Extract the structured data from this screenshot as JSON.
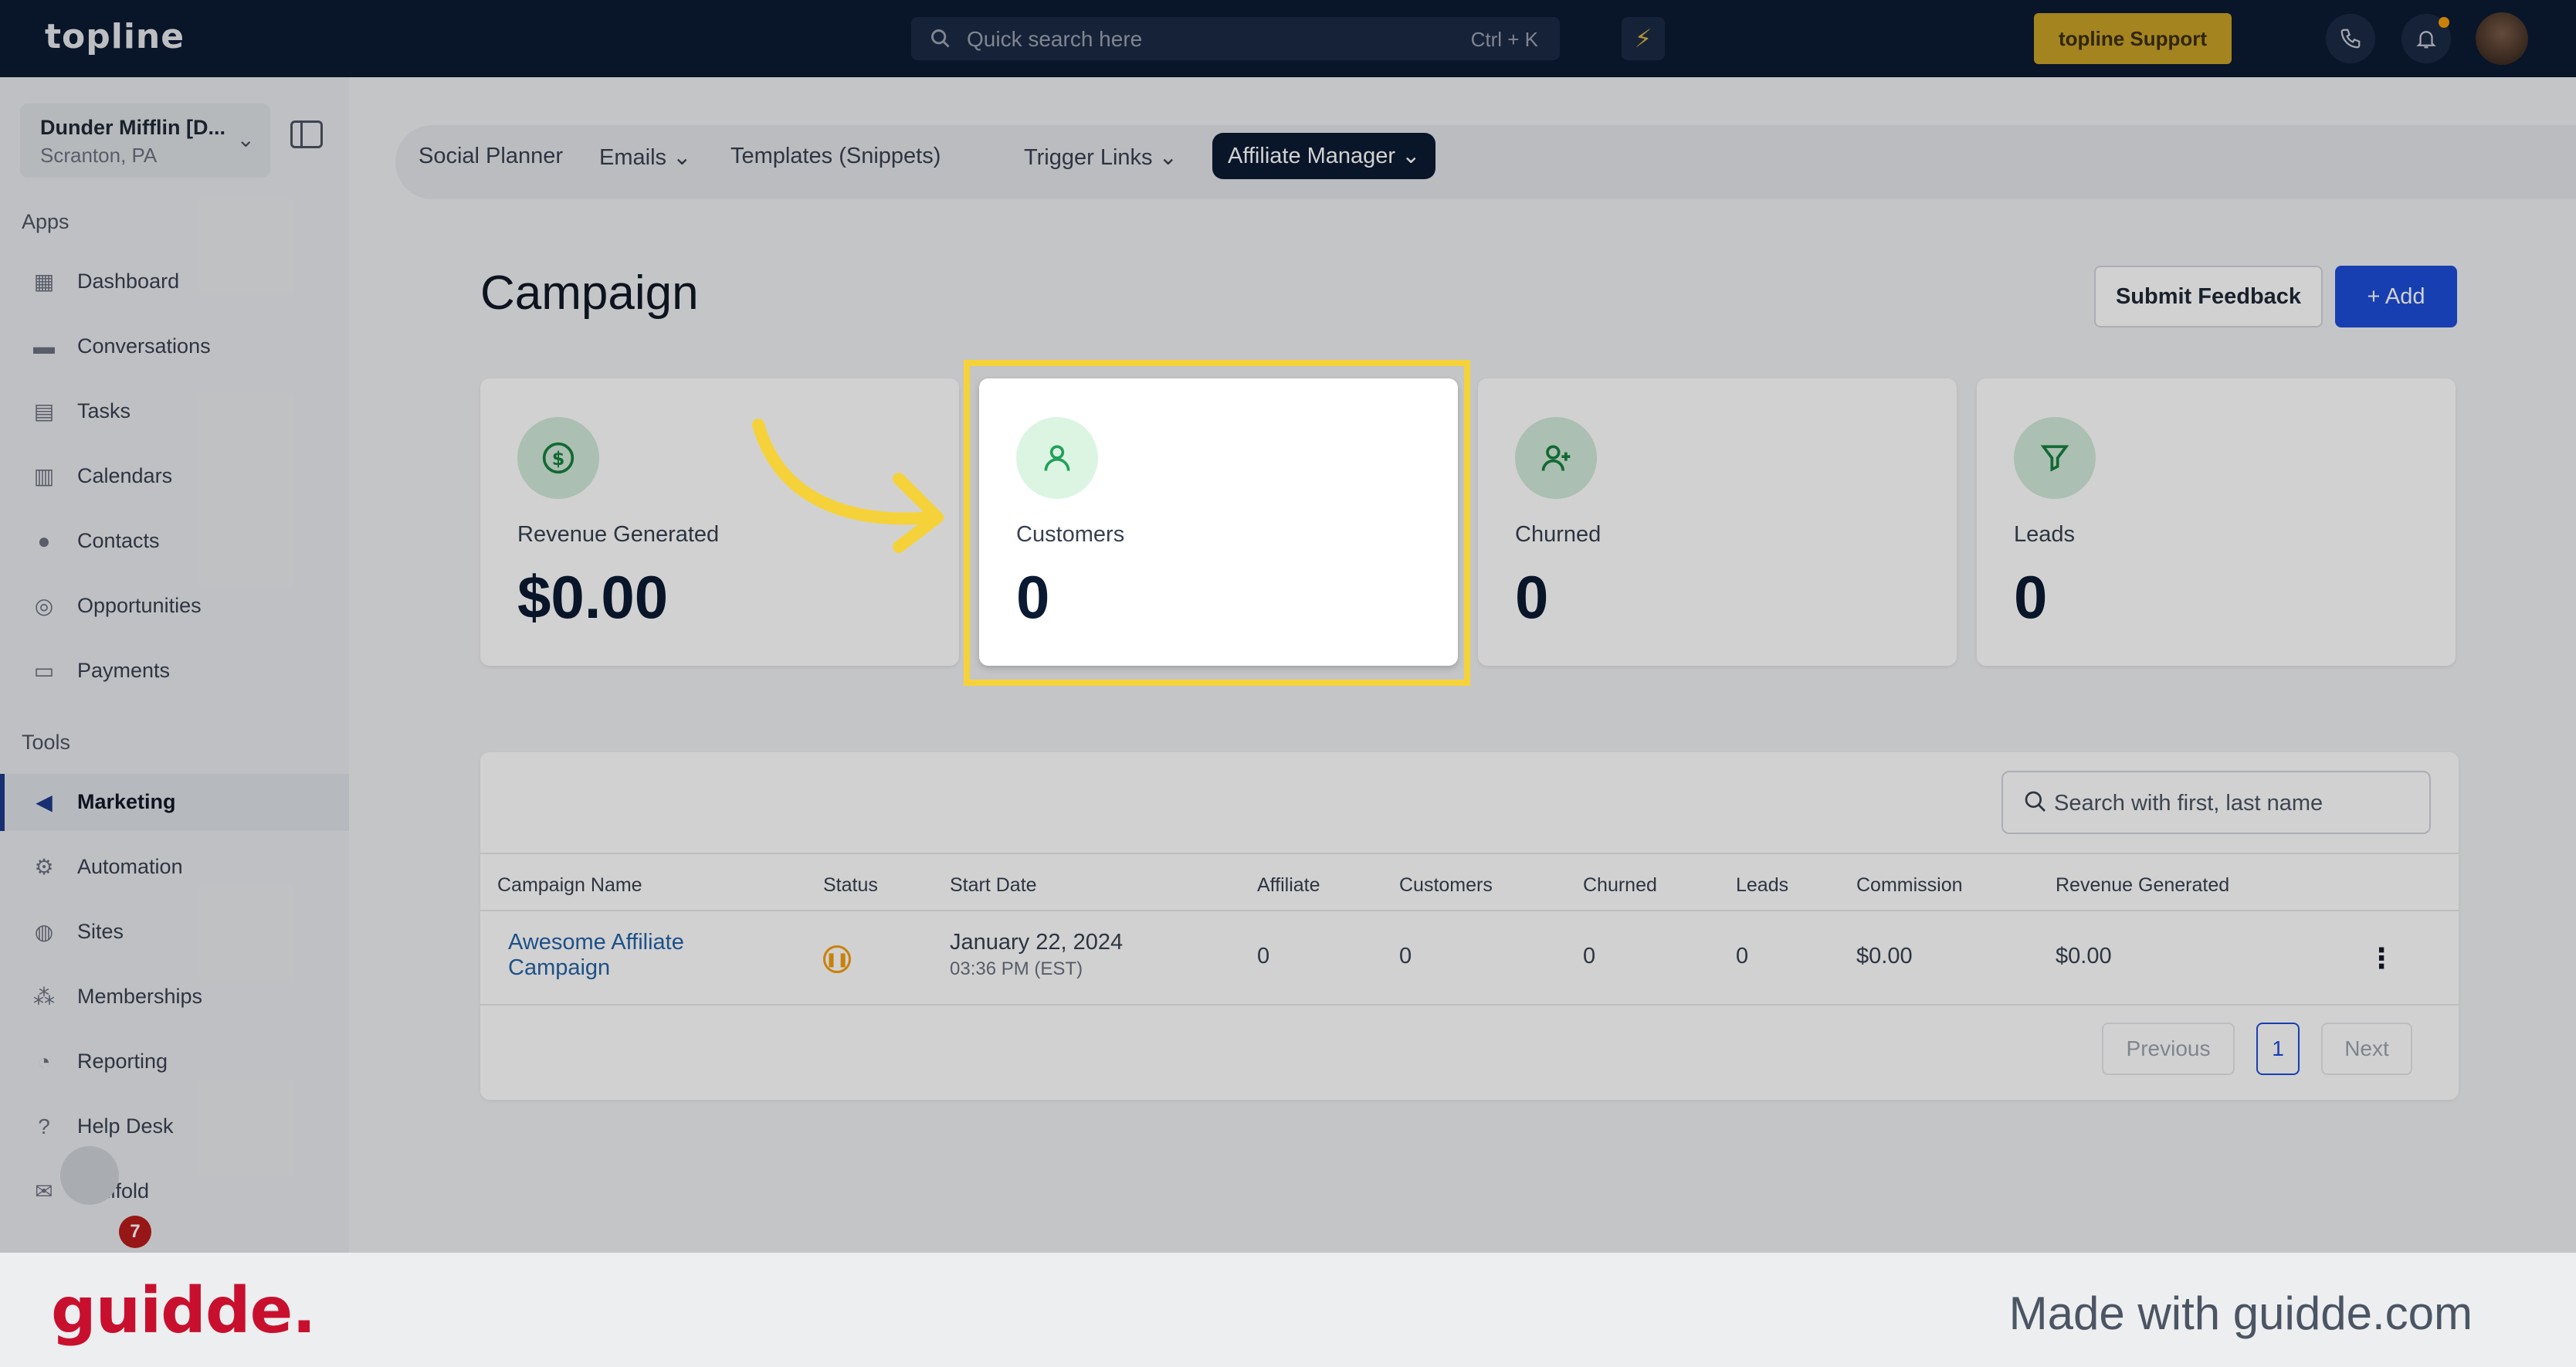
{
  "topbar": {
    "logo": "topline",
    "search_placeholder": "Quick search here",
    "search_shortcut": "Ctrl + K",
    "support_label": "topline Support"
  },
  "sidebar": {
    "location_name": "Dunder Mifflin [D...",
    "location_city": "Scranton, PA",
    "apps_label": "Apps",
    "tools_label": "Tools",
    "apps": [
      {
        "label": "Dashboard",
        "icon": "dashboard-icon"
      },
      {
        "label": "Conversations",
        "icon": "chat-icon"
      },
      {
        "label": "Tasks",
        "icon": "tasks-icon"
      },
      {
        "label": "Calendars",
        "icon": "calendar-icon"
      },
      {
        "label": "Contacts",
        "icon": "contacts-icon"
      },
      {
        "label": "Opportunities",
        "icon": "target-icon"
      },
      {
        "label": "Payments",
        "icon": "card-icon"
      }
    ],
    "tools": [
      {
        "label": "Marketing",
        "icon": "megaphone-icon",
        "active": true
      },
      {
        "label": "Automation",
        "icon": "gears-icon"
      },
      {
        "label": "Sites",
        "icon": "globe-icon"
      },
      {
        "label": "Memberships",
        "icon": "members-icon"
      },
      {
        "label": "Reporting",
        "icon": "pie-icon"
      },
      {
        "label": "Help Desk",
        "icon": "help-icon"
      },
      {
        "label": "Mailfold",
        "icon": "mail-icon"
      }
    ],
    "notification_count": "7"
  },
  "tabs": {
    "social": "Social Planner",
    "emails": "Emails",
    "templates": "Templates (Snippets)",
    "trigger": "Trigger Links",
    "affiliate": "Affiliate Manager"
  },
  "page": {
    "title": "Campaign",
    "feedback_label": "Submit Feedback",
    "add_label": "+ Add"
  },
  "stats": {
    "revenue_label": "Revenue Generated",
    "revenue_value": "$0.00",
    "customers_label": "Customers",
    "customers_value": "0",
    "churned_label": "Churned",
    "churned_value": "0",
    "leads_label": "Leads",
    "leads_value": "0"
  },
  "table": {
    "search_placeholder": "Search with first, last name",
    "headers": {
      "name": "Campaign Name",
      "status": "Status",
      "start": "Start Date",
      "affiliate": "Affiliate",
      "customers": "Customers",
      "churned": "Churned",
      "leads": "Leads",
      "commission": "Commission",
      "revenue": "Revenue Generated"
    },
    "row": {
      "name_line1": "Awesome Affiliate",
      "name_line2": "Campaign",
      "start_date": "January 22, 2024",
      "start_time": "03:36 PM (EST)",
      "affiliate": "0",
      "customers": "0",
      "churned": "0",
      "leads": "0",
      "commission": "$0.00",
      "revenue": "$0.00"
    },
    "pagination": {
      "previous": "Previous",
      "page": "1",
      "next": "Next"
    }
  },
  "footer": {
    "logo": "guidde.",
    "made_with": "Made with guidde.com"
  },
  "colors": {
    "navy": "#0b1a33",
    "accent_blue": "#1d4ed8",
    "highlight_yellow": "#f6d23a",
    "guidde_red": "#c8102e"
  }
}
